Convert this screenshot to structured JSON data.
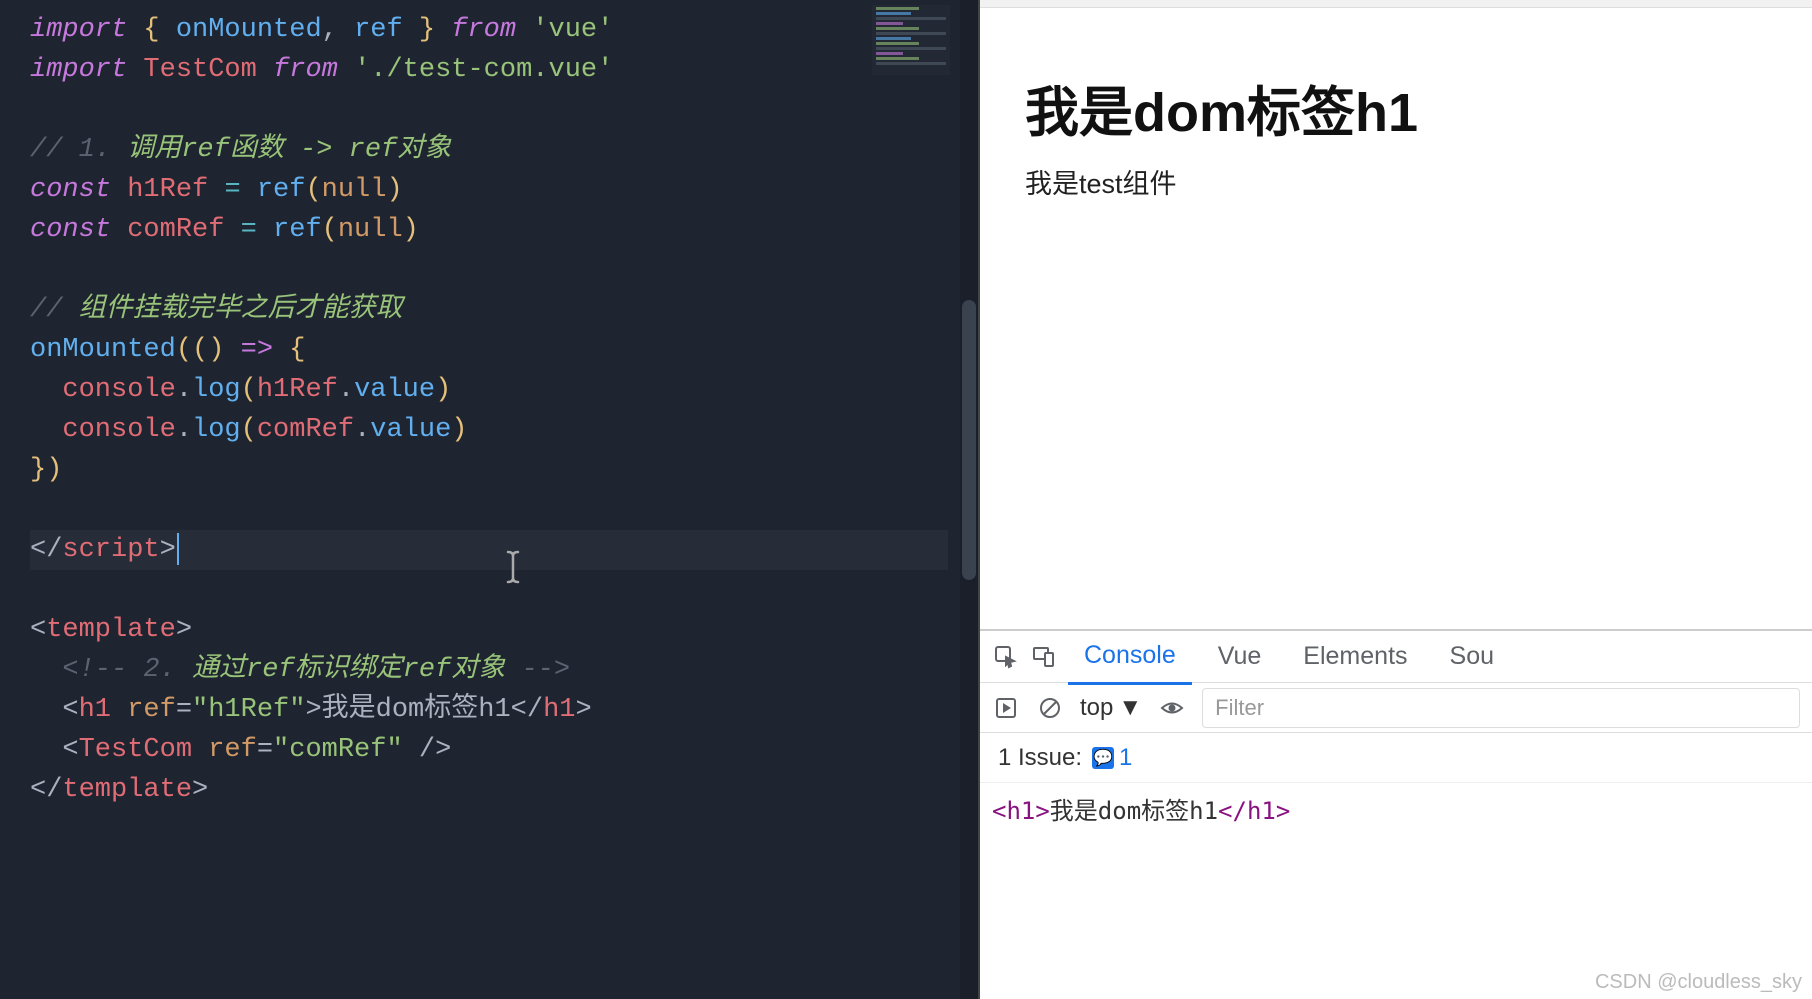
{
  "editor": {
    "lines": {
      "l1": {
        "t1": "import",
        "t2": " { ",
        "t3": "onMounted",
        "t4": ", ",
        "t5": "ref",
        "t6": " } ",
        "t7": "from",
        "t8": " ",
        "t9": "'vue'"
      },
      "l2": {
        "t1": "import",
        "t2": " ",
        "t3": "TestCom",
        "t4": " ",
        "t5": "from",
        "t6": " ",
        "t7": "'./test-com.vue'"
      },
      "l4": {
        "t1": "// 1. ",
        "t2": "调用ref函数 -> ref对象"
      },
      "l5": {
        "t1": "const",
        "t2": " ",
        "t3": "h1Ref",
        "t4": " ",
        "t5": "=",
        "t6": " ",
        "t7": "ref",
        "t8": "(",
        "t9": "null",
        "t10": ")"
      },
      "l6": {
        "t1": "const",
        "t2": " ",
        "t3": "comRef",
        "t4": " ",
        "t5": "=",
        "t6": " ",
        "t7": "ref",
        "t8": "(",
        "t9": "null",
        "t10": ")"
      },
      "l8": {
        "t1": "// ",
        "t2": "组件挂载完毕之后才能获取"
      },
      "l9": {
        "t1": "onMounted",
        "t2": "(",
        "t3": "()",
        "t4": " ",
        "t5": "=>",
        "t6": " ",
        "t7": "{"
      },
      "l10": {
        "t1": "  console",
        "t2": ".",
        "t3": "log",
        "t4": "(",
        "t5": "h1Ref",
        "t6": ".",
        "t7": "value",
        "t8": ")"
      },
      "l11": {
        "t1": "  console",
        "t2": ".",
        "t3": "log",
        "t4": "(",
        "t5": "comRef",
        "t6": ".",
        "t7": "value",
        "t8": ")"
      },
      "l12": {
        "t1": "}",
        "t2": ")"
      },
      "l14": {
        "t1": "<",
        "t2": "/",
        "t3": "script",
        "t4": ">"
      },
      "l16": {
        "t1": "<",
        "t2": "template",
        "t3": ">"
      },
      "l17": {
        "t1": "  ",
        "t2": "<!-- 2. ",
        "t3": "通过ref标识绑定ref对象",
        "t4": " -->"
      },
      "l18": {
        "t1": "  ",
        "t2": "<",
        "t3": "h1",
        "t4": " ",
        "t5": "ref",
        "t6": "=",
        "t7": "\"h1Ref\"",
        "t8": ">",
        "t9": "我是dom标签h1",
        "t10": "<",
        "t11": "/",
        "t12": "h1",
        "t13": ">"
      },
      "l19": {
        "t1": "  ",
        "t2": "<",
        "t3": "TestCom",
        "t4": " ",
        "t5": "ref",
        "t6": "=",
        "t7": "\"comRef\"",
        "t8": " />"
      },
      "l20": {
        "t1": "<",
        "t2": "/",
        "t3": "template",
        "t4": ">"
      }
    }
  },
  "page": {
    "h1": "我是dom标签h1",
    "text": "我是test组件"
  },
  "devtools": {
    "tabs": {
      "console": "Console",
      "vue": "Vue",
      "elements": "Elements",
      "sources": "Sou"
    },
    "controls": {
      "scope": "top",
      "filter_placeholder": "Filter"
    },
    "issues": {
      "label": "1 Issue:",
      "count": "1"
    },
    "console_line": {
      "t1": "<h1>",
      "t2": "我是dom标签h1",
      "t3": "</h1>"
    }
  },
  "watermark": "CSDN @cloudless_sky"
}
